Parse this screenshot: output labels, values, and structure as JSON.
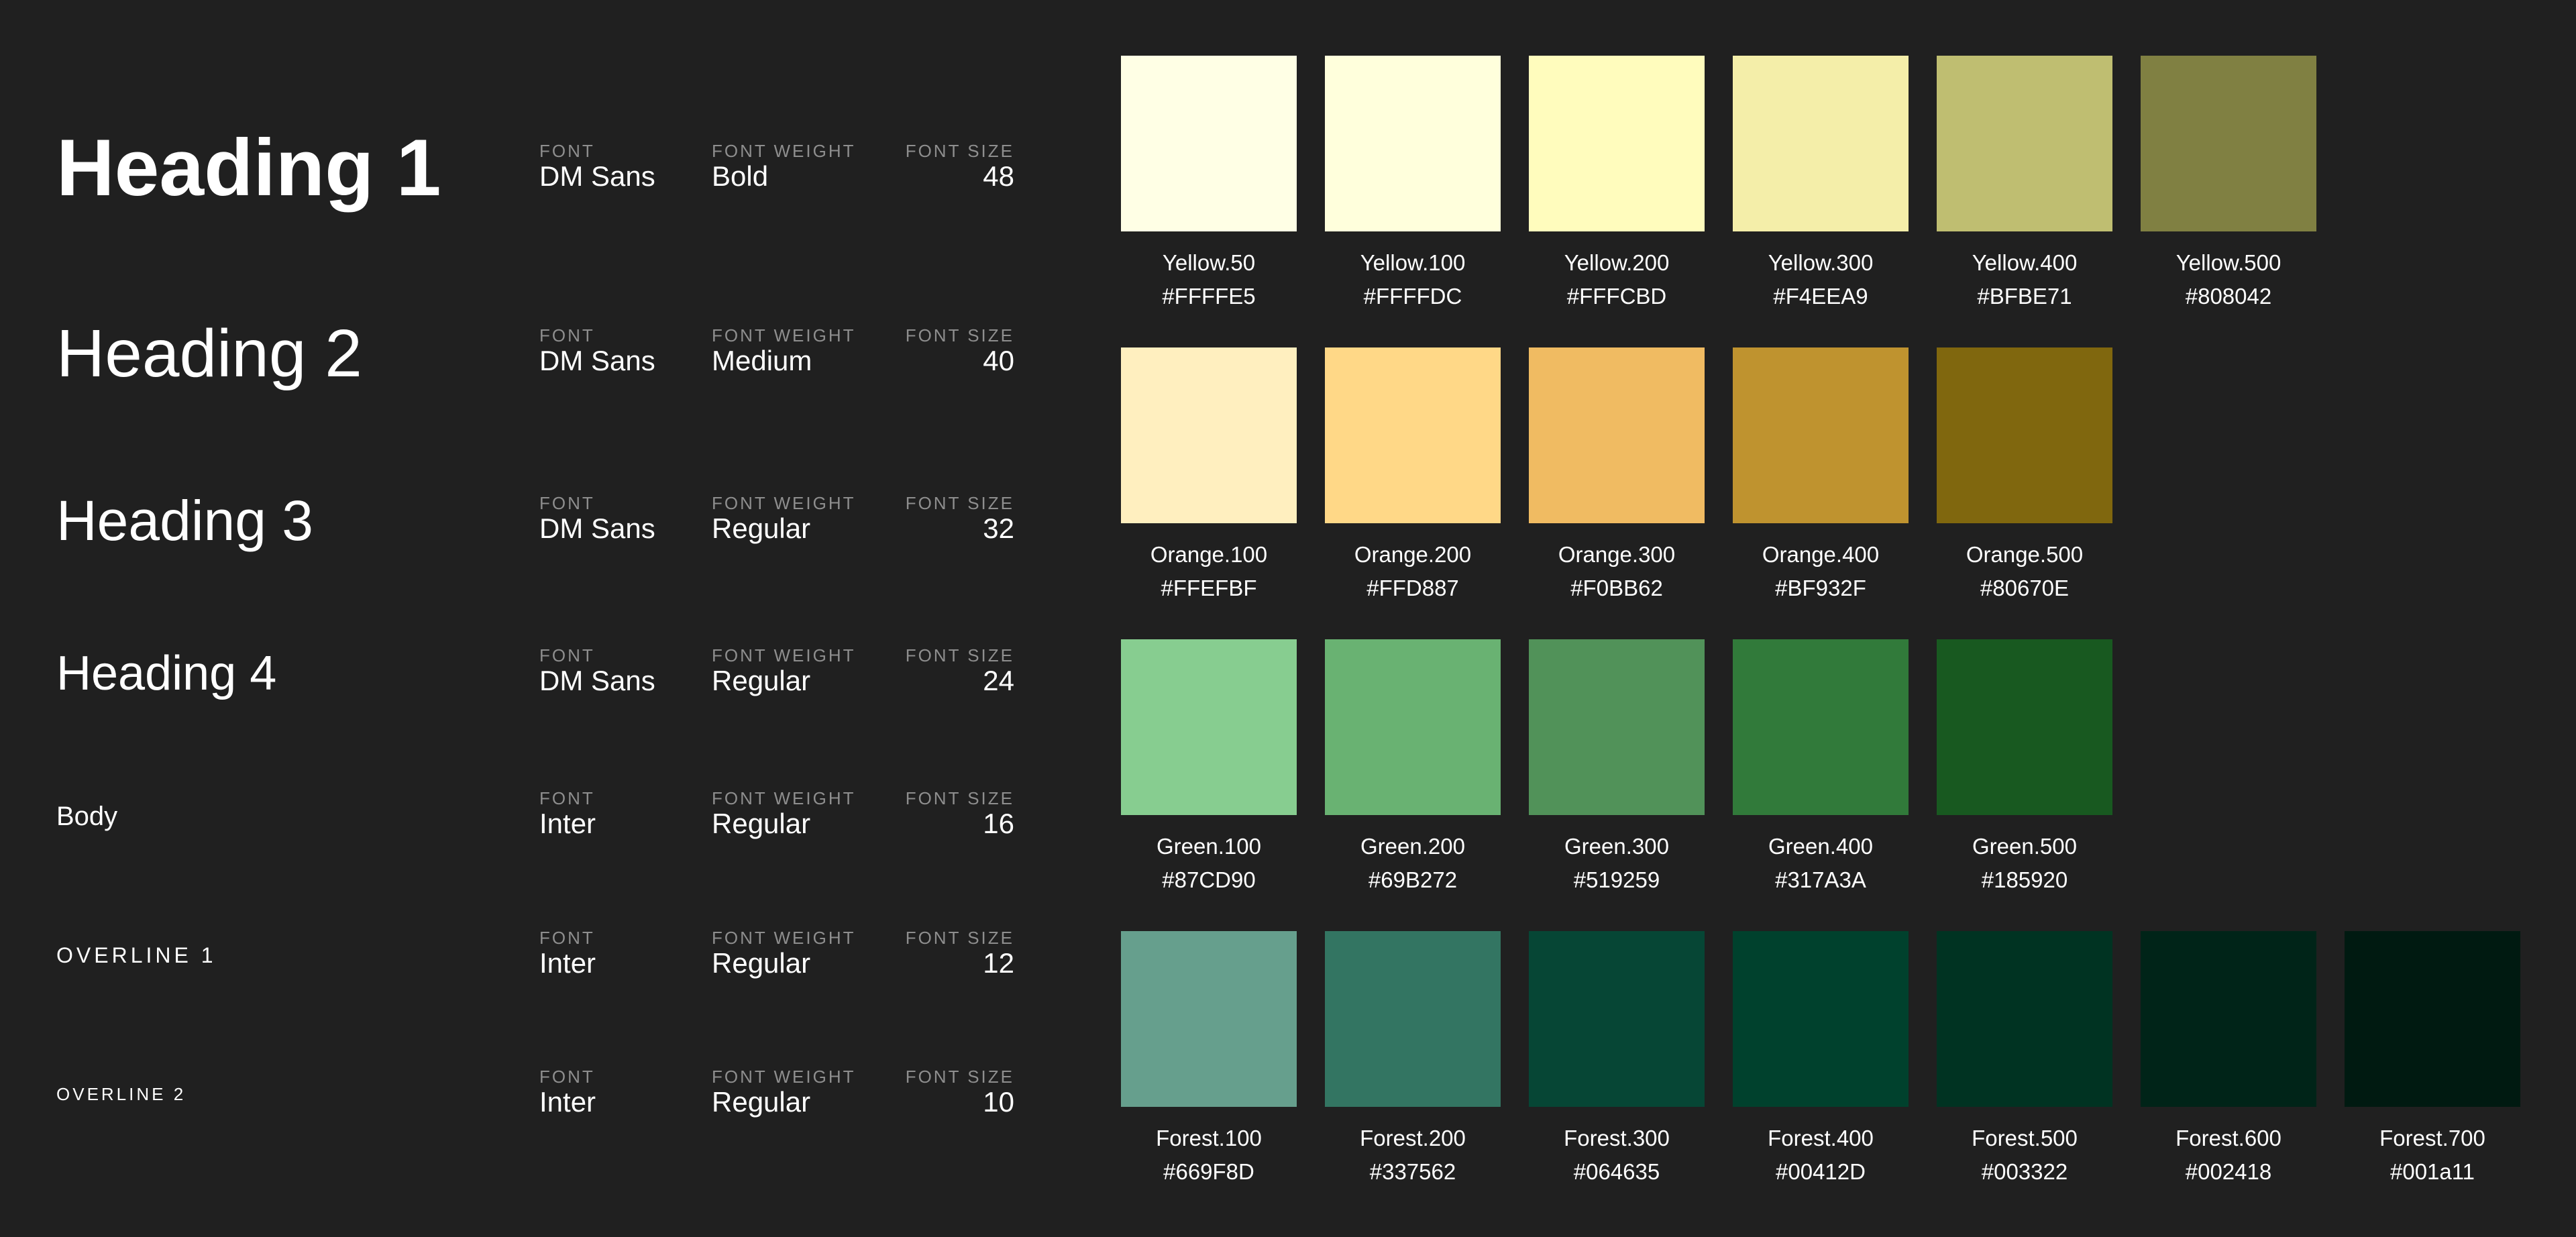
{
  "typography": {
    "font_label": "FONT",
    "weight_label": "FONT WEIGHT",
    "size_label": "FONT SIZE",
    "rows": [
      {
        "sample": "Heading 1",
        "font": "DM Sans",
        "weight": "Bold",
        "size": "48"
      },
      {
        "sample": "Heading 2",
        "font": "DM Sans",
        "weight": "Medium",
        "size": "40"
      },
      {
        "sample": "Heading 3",
        "font": "DM Sans",
        "weight": "Regular",
        "size": "32"
      },
      {
        "sample": "Heading 4",
        "font": "DM Sans",
        "weight": "Regular",
        "size": "24"
      },
      {
        "sample": "Body",
        "font": "Inter",
        "weight": "Regular",
        "size": "16"
      },
      {
        "sample": "OVERLINE 1",
        "font": "Inter",
        "weight": "Regular",
        "size": "12"
      },
      {
        "sample": "OVERLINE 2",
        "font": "Inter",
        "weight": "Regular",
        "size": "10"
      }
    ]
  },
  "palette": {
    "groups": [
      {
        "swatches": [
          {
            "name": "Yellow.50",
            "hex": "#FFFFE5",
            "color": "#FFFFE5"
          },
          {
            "name": "Yellow.100",
            "hex": "#FFFFDC",
            "color": "#FFFFDC"
          },
          {
            "name": "Yellow.200",
            "hex": "#FFFCBD",
            "color": "#FFFCBD"
          },
          {
            "name": "Yellow.300",
            "hex": "#F4EEA9",
            "color": "#F4EEA9"
          },
          {
            "name": "Yellow.400",
            "hex": "#BFBE71",
            "color": "#BFBE71"
          },
          {
            "name": "Yellow.500",
            "hex": "#808042",
            "color": "#808042"
          }
        ]
      },
      {
        "swatches": [
          {
            "name": "Orange.100",
            "hex": "#FFEFBF",
            "color": "#FFEFBF"
          },
          {
            "name": "Orange.200",
            "hex": "#FFD887",
            "color": "#FFD887"
          },
          {
            "name": "Orange.300",
            "hex": "#F0BB62",
            "color": "#F0BB62"
          },
          {
            "name": "Orange.400",
            "hex": "#BF932F",
            "color": "#BF932F"
          },
          {
            "name": "Orange.500",
            "hex": "#80670E",
            "color": "#80670E"
          }
        ]
      },
      {
        "swatches": [
          {
            "name": "Green.100",
            "hex": "#87CD90",
            "color": "#87CD90"
          },
          {
            "name": "Green.200",
            "hex": "#69B272",
            "color": "#69B272"
          },
          {
            "name": "Green.300",
            "hex": "#519259",
            "color": "#519259"
          },
          {
            "name": "Green.400",
            "hex": "#317A3A",
            "color": "#317A3A"
          },
          {
            "name": "Green.500",
            "hex": "#185920",
            "color": "#185920"
          }
        ]
      },
      {
        "swatches": [
          {
            "name": "Forest.100",
            "hex": "#669F8D",
            "color": "#669F8D"
          },
          {
            "name": "Forest.200",
            "hex": "#337562",
            "color": "#337562"
          },
          {
            "name": "Forest.300",
            "hex": "#064635",
            "color": "#064635"
          },
          {
            "name": "Forest.400",
            "hex": "#00412D",
            "color": "#00412D"
          },
          {
            "name": "Forest.500",
            "hex": "#003322",
            "color": "#003322"
          },
          {
            "name": "Forest.600",
            "hex": "#002418",
            "color": "#002418"
          },
          {
            "name": "Forest.700",
            "hex": "#001a11",
            "color": "#001a11"
          }
        ]
      }
    ]
  },
  "colors": {
    "background": "#202020",
    "label": "#8e8e8e",
    "text": "#ffffff"
  }
}
